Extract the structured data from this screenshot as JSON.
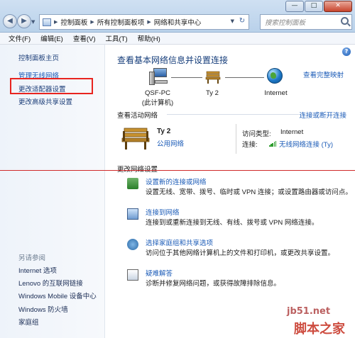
{
  "window": {
    "minimize_glyph": "—",
    "maximize_glyph": "□",
    "close_glyph": "✕"
  },
  "address": {
    "crumbs": [
      "控制面板",
      "所有控制面板项",
      "网络和共享中心"
    ],
    "search_placeholder": "搜索控制面板"
  },
  "menu": [
    "文件(F)",
    "编辑(E)",
    "查看(V)",
    "工具(T)",
    "帮助(H)"
  ],
  "sidebar": {
    "items": [
      "控制面板主页",
      "管理无线网络",
      "更改适配器设置",
      "更改高级共享设置"
    ],
    "see_also_label": "另请参阅",
    "see_also": [
      "Internet 选项",
      "Lenovo 的互联网链接",
      "Windows Mobile 设备中心",
      "Windows 防火墙",
      "家庭组"
    ]
  },
  "main": {
    "title": "查看基本网络信息并设置连接",
    "full_map_link": "查看完整映射",
    "nodes": {
      "pc_name": "QSF-PC",
      "pc_sub": "(此计算机)",
      "network": "Ty 2",
      "internet": "Internet"
    },
    "active_header": "查看活动网络",
    "connect_link": "连接或断开连接",
    "active": {
      "name": "Ty 2",
      "type": "公用网络",
      "access_label": "访问类型:",
      "access_value": "Internet",
      "conn_label": "连接:",
      "conn_value": "无线网络连接 (Ty)"
    },
    "change_header": "更改网络设置",
    "tasks": [
      {
        "title": "设置新的连接或网络",
        "desc": "设置无线、宽带、拨号、临时或 VPN 连接；或设置路由器或访问点。"
      },
      {
        "title": "连接到网络",
        "desc": "连接到或重新连接到无线、有线、拨号或 VPN 网络连接。"
      },
      {
        "title": "选择家庭组和共享选项",
        "desc": "访问位于其他网络计算机上的文件和打印机，或更改共享设置。"
      },
      {
        "title": "疑难解答",
        "desc": "诊断并修复网络问题，或获得故障排除信息。"
      }
    ]
  },
  "watermark": {
    "site": "jb51.net",
    "name": "脚本之家"
  },
  "colors": {
    "link": "#1b5bb7",
    "highlight": "#e8241f",
    "title": "#143c7a"
  }
}
